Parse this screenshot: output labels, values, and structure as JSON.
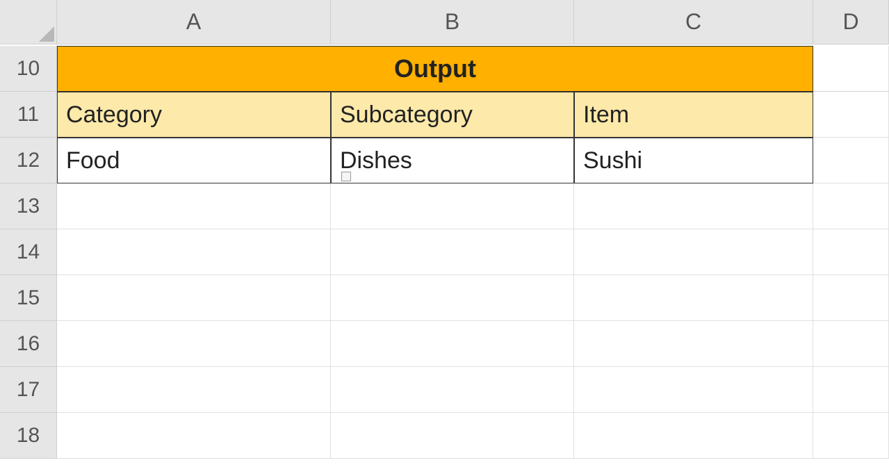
{
  "columns": [
    "A",
    "B",
    "C",
    "D"
  ],
  "rows": [
    "10",
    "11",
    "12",
    "13",
    "14",
    "15",
    "16",
    "17",
    "18"
  ],
  "output": {
    "title": "Output",
    "headers": {
      "category": "Category",
      "subcategory": "Subcategory",
      "item": "Item"
    },
    "data": {
      "category": "Food",
      "subcategory": "Dishes",
      "item": " Sushi"
    }
  }
}
